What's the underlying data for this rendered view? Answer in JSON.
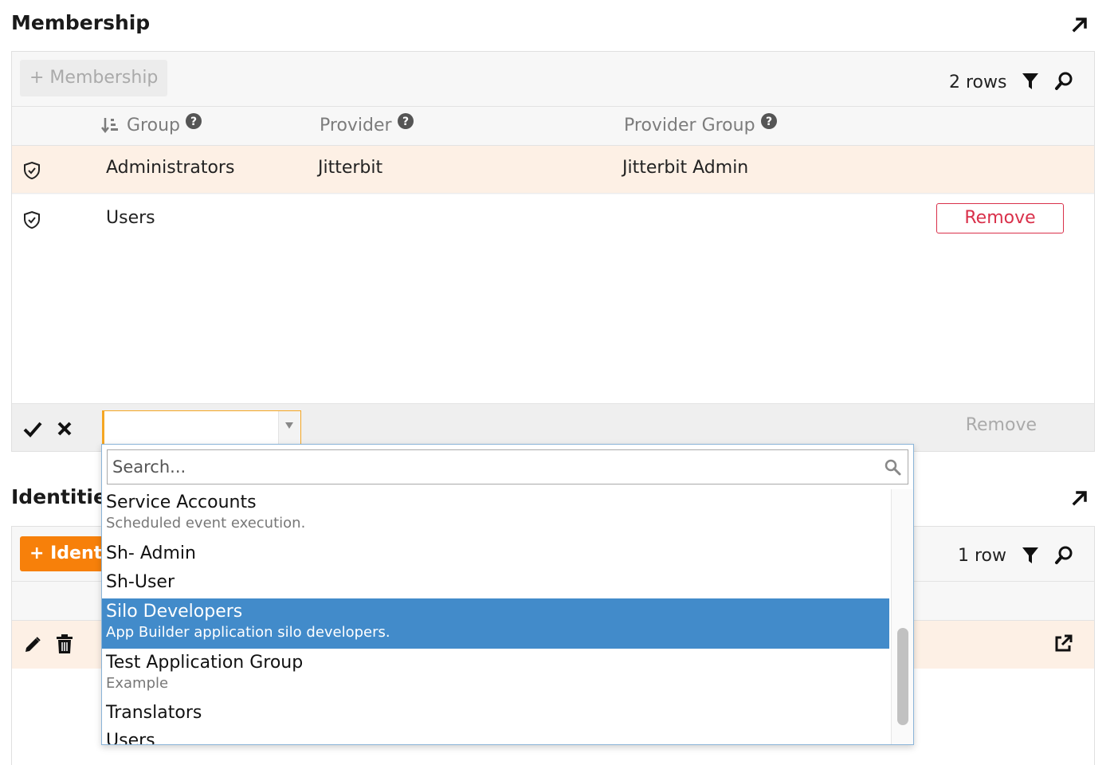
{
  "membership": {
    "title": "Membership",
    "add_button": "+ Membership",
    "rows_count": "2 rows",
    "columns": [
      "Group",
      "Provider",
      "Provider Group"
    ],
    "rows": [
      {
        "group": "Administrators",
        "provider": "Jitterbit",
        "provider_group": "Jitterbit Admin"
      },
      {
        "group": "Users",
        "provider": "",
        "provider_group": "",
        "remove_label": "Remove"
      }
    ],
    "edit_remove_label": "Remove"
  },
  "identities": {
    "title": "Identities",
    "add_button": "+ Identity",
    "rows_count": "1 row"
  },
  "dropdown": {
    "search_placeholder": "Search...",
    "items": [
      {
        "label": "Service Accounts",
        "description": "Scheduled event execution."
      },
      {
        "label": "Sh- Admin",
        "description": ""
      },
      {
        "label": "Sh-User",
        "description": ""
      },
      {
        "label": "Silo Developers",
        "description": "App Builder application silo developers.",
        "selected": true
      },
      {
        "label": "Test Application Group",
        "description": "Example"
      },
      {
        "label": "Translators",
        "description": ""
      },
      {
        "label": "Users",
        "description": ""
      }
    ]
  },
  "colors": {
    "accent_orange": "#f7800a",
    "selected_blue": "#428bca",
    "row_highlight": "#fdf0e5",
    "remove_red": "#d9304a"
  }
}
